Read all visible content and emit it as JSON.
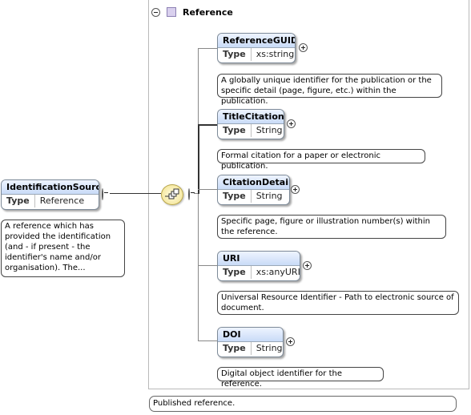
{
  "group": {
    "title": "Reference"
  },
  "root": {
    "name": "IdentificationSource",
    "type_label": "Type",
    "type_value": "Reference",
    "doc": "A reference which has provided the identification (and - if present - the identifier's name and/or organisation). The..."
  },
  "children": [
    {
      "name": "ReferenceGUID",
      "type_label": "Type",
      "type_value": "xs:string",
      "doc": "A globally unique identifier for the publication or the specific detail (page, figure, etc.) within the publication."
    },
    {
      "name": "TitleCitation",
      "type_label": "Type",
      "type_value": "String",
      "doc": "Formal citation for a paper or electronic publication."
    },
    {
      "name": "CitationDetail",
      "type_label": "Type",
      "type_value": "String",
      "doc": "Specific page, figure or illustration number(s) within the reference."
    },
    {
      "name": "URI",
      "type_label": "Type",
      "type_value": "xs:anyURI",
      "doc": "Universal Resource Identifier - Path to electronic source of document."
    },
    {
      "name": "DOI",
      "type_label": "Type",
      "type_value": "String",
      "doc": "Digital object identifier for the reference."
    }
  ],
  "group_doc": "Published reference."
}
